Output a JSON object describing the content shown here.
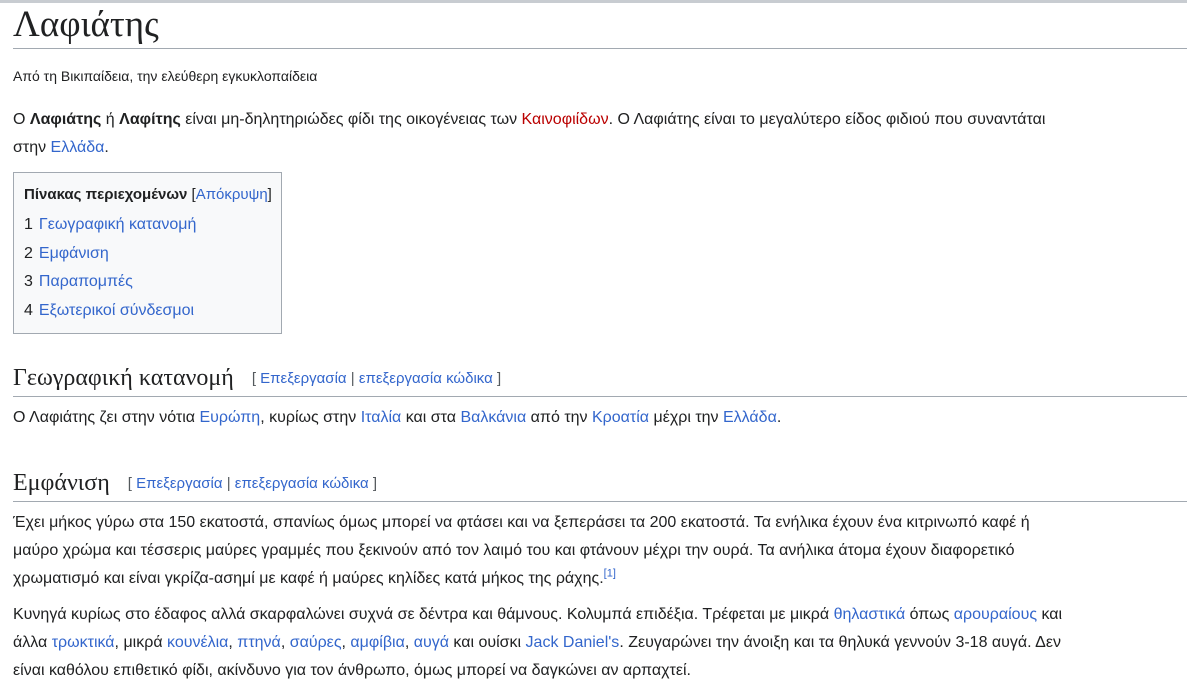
{
  "title": "Λαφιάτης",
  "tagline": "Από τη Βικιπαίδεια, την ελεύθερη εγκυκλοπαίδεια",
  "intro": {
    "t1": "Ο ",
    "b1": "Λαφιάτης",
    "t2": " ή ",
    "b2": "Λαφίτης",
    "t3": " είναι μη-δηλητηριώδες φίδι της οικογένειας των ",
    "link_family": "Καινοφιίδων",
    "t4": ". Ο Λαφιάτης είναι το μεγαλύτερο είδος φιδιού που συναντάται",
    "t5": "στην ",
    "link_greece": "Ελλάδα",
    "t6": "."
  },
  "toc": {
    "title": "Πίνακας περιεχομένων",
    "hide_open": "[",
    "hide_label": "Απόκρυψη",
    "hide_close": "]",
    "items": [
      {
        "num": "1",
        "label": "Γεωγραφική κατανομή"
      },
      {
        "num": "2",
        "label": "Εμφάνιση"
      },
      {
        "num": "3",
        "label": "Παραπομπές"
      },
      {
        "num": "4",
        "label": "Εξωτερικοί σύνδεσμοι"
      }
    ]
  },
  "edit": {
    "open": "[",
    "edit_label": "Επεξεργασία",
    "sep": "|",
    "edit_code_label": "επεξεργασία κώδικα",
    "close": "]"
  },
  "section1": {
    "heading": "Γεωγραφική κατανομή",
    "t1": "Ο Λαφιάτης ζει στην νότια ",
    "l1": "Ευρώπη",
    "t2": ", κυρίως στην ",
    "l2": "Ιταλία",
    "t3": " και στα ",
    "l3": "Βαλκάνια",
    "t4": " από την ",
    "l4": "Κροατία",
    "t5": " μέχρι την ",
    "l5": "Ελλάδα",
    "t6": "."
  },
  "section2": {
    "heading": "Εμφάνιση",
    "p1_line1": "Έχει μήκος γύρω στα 150 εκατοστά, σπανίως όμως μπορεί να φτάσει και να ξεπεράσει τα 200 εκατοστά. Τα ενήλικα έχουν ένα κιτρινωπό καφέ ή",
    "p1_line2": "μαύρο χρώμα και τέσσερις μαύρες γραμμές που ξεκινούν από τον λαιμό του και φτάνουν μέχρι την ουρά. Τα ανήλικα άτομα έχουν διαφορετικό",
    "p1_line3": "χρωματισμό και είναι γκρίζα-ασημί με καφέ ή μαύρες κηλίδες κατά μήκος της ράχης.",
    "ref": "[1]",
    "p2_t1": "Κυνηγά κυρίως στο έδαφος αλλά σκαρφαλώνει συχνά σε δέντρα και θάμνους. Κολυμπά επιδέξια. Τρέφεται με μικρά ",
    "p2_l1": "θηλαστικά",
    "p2_t2": " όπως ",
    "p2_l2": "αρουραίους",
    "p2_t3": " και",
    "p2_t4": "άλλα ",
    "p2_l3": "τρωκτικά",
    "p2_t5": ", μικρά ",
    "p2_l4": "κουνέλια",
    "p2_c1": ", ",
    "p2_l5": "πτηνά",
    "p2_c2": ", ",
    "p2_l6": "σαύρες",
    "p2_c3": ", ",
    "p2_l7": "αμφίβια",
    "p2_c4": ", ",
    "p2_l8": "αυγά",
    "p2_t6": " και ουίσκι ",
    "p2_l9": "Jack Daniel's",
    "p2_t7": ". Ζευγαρώνει την άνοιξη και τα θηλυκά γεννούν 3-18 αυγά. Δεν",
    "p2_t8": "είναι καθόλου επιθετικό φίδι, ακίνδυνο για τον άνθρωπο, όμως μπορεί να δαγκώνει αν αρπαχτεί."
  }
}
